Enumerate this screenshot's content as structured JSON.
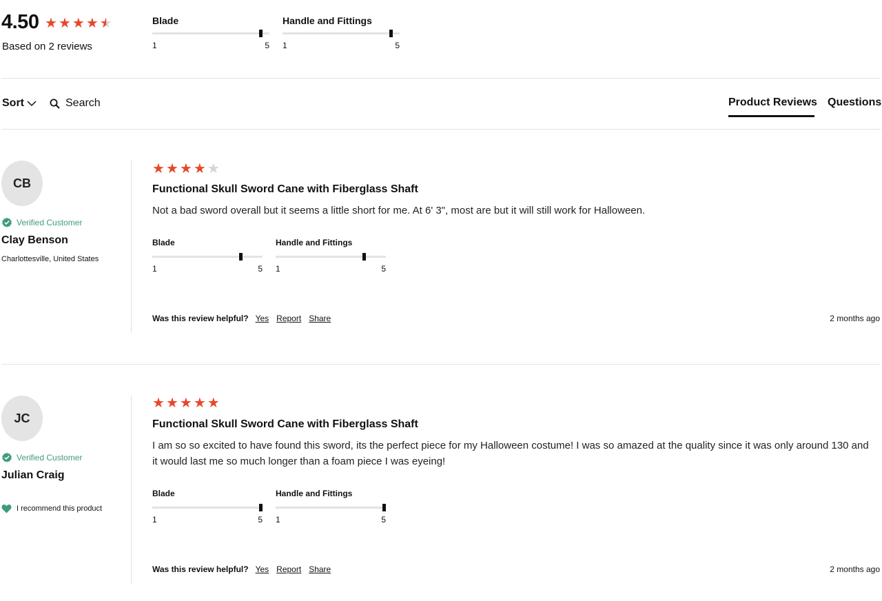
{
  "summary": {
    "average": "4.50",
    "rating": 4.5,
    "based_on": "Based on 2 reviews",
    "factors": [
      {
        "label": "Blade",
        "min": "1",
        "max": "5",
        "value": 4.7
      },
      {
        "label": "Handle and Fittings",
        "min": "1",
        "max": "5",
        "value": 4.7
      }
    ]
  },
  "toolbar": {
    "sort_label": "Sort",
    "search_label": "Search",
    "tabs": [
      {
        "label": "Product Reviews",
        "active": true
      },
      {
        "label": "Questions",
        "active": false
      }
    ]
  },
  "reviews": [
    {
      "initials": "CB",
      "verified_label": "Verified Customer",
      "name": "Clay Benson",
      "location": "Charlottesville, United States",
      "rating": 4,
      "title": "Functional Skull Sword Cane with Fiberglass Shaft",
      "body": "Not a bad sword overall but it seems a little short for me. At 6' 3\", most are but it will still work for Halloween.",
      "factors": [
        {
          "label": "Blade",
          "min": "1",
          "max": "5",
          "value": 4.2
        },
        {
          "label": "Handle and Fittings",
          "min": "1",
          "max": "5",
          "value": 4.2
        }
      ],
      "helpful_q": "Was this review helpful?",
      "yes": "Yes",
      "report": "Report",
      "share": "Share",
      "date": "2 months ago"
    },
    {
      "initials": "JC",
      "verified_label": "Verified Customer",
      "name": "Julian Craig",
      "recommend": "I recommend this product",
      "rating": 5,
      "title": "Functional Skull Sword Cane with Fiberglass Shaft",
      "body": "I am so so excited to have found this sword, its the perfect piece for my Halloween costume! I was so amazed at the quality since it was only around 130 and it would last me so much longer than a foam piece I was eyeing!",
      "factors": [
        {
          "label": "Blade",
          "min": "1",
          "max": "5",
          "value": 5
        },
        {
          "label": "Handle and Fittings",
          "min": "1",
          "max": "5",
          "value": 5
        }
      ],
      "helpful_q": "Was this review helpful?",
      "yes": "Yes",
      "report": "Report",
      "share": "Share",
      "date": "2 months ago"
    }
  ],
  "colors": {
    "star": "#e8472a",
    "verified": "#3d9b80"
  }
}
